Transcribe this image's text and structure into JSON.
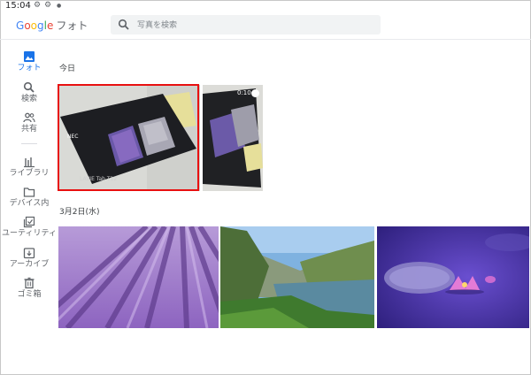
{
  "status_bar": {
    "time": "15:04"
  },
  "app": {
    "logo_google": [
      "G",
      "o",
      "o",
      "g",
      "l",
      "e"
    ],
    "logo_product": "フォト"
  },
  "search": {
    "placeholder": "写真を検索"
  },
  "sidebar": {
    "items": [
      {
        "label": "フォト",
        "icon": "photo-icon",
        "active": true
      },
      {
        "label": "検索",
        "icon": "search-icon",
        "active": false
      },
      {
        "label": "共有",
        "icon": "people-icon",
        "active": false
      },
      {
        "label": "ライブラリ",
        "icon": "library-icon",
        "active": false
      },
      {
        "label": "デバイス内",
        "icon": "folder-icon",
        "active": false
      },
      {
        "label": "ユーティリティ",
        "icon": "utility-icon",
        "active": false
      },
      {
        "label": "アーカイブ",
        "icon": "archive-icon",
        "active": false
      },
      {
        "label": "ゴミ箱",
        "icon": "trash-icon",
        "active": false
      }
    ]
  },
  "sections": [
    {
      "title": "今日",
      "items": [
        {
          "kind": "photo",
          "subject": "NEC LAVIE Tab box",
          "box_text": [
            "NEC",
            "LAVIE Tab T12"
          ]
        },
        {
          "kind": "video",
          "duration": "0:10"
        }
      ]
    },
    {
      "title": "3月2日(水)",
      "items": [
        {
          "kind": "photo",
          "subject": "lavender field"
        },
        {
          "kind": "photo",
          "subject": "mountain lake"
        },
        {
          "kind": "photo",
          "subject": "lotus on purple water"
        }
      ]
    }
  ],
  "colors": {
    "accent": "#1a73e8",
    "selection": "#e81010",
    "search_bg": "#f1f3f4"
  }
}
